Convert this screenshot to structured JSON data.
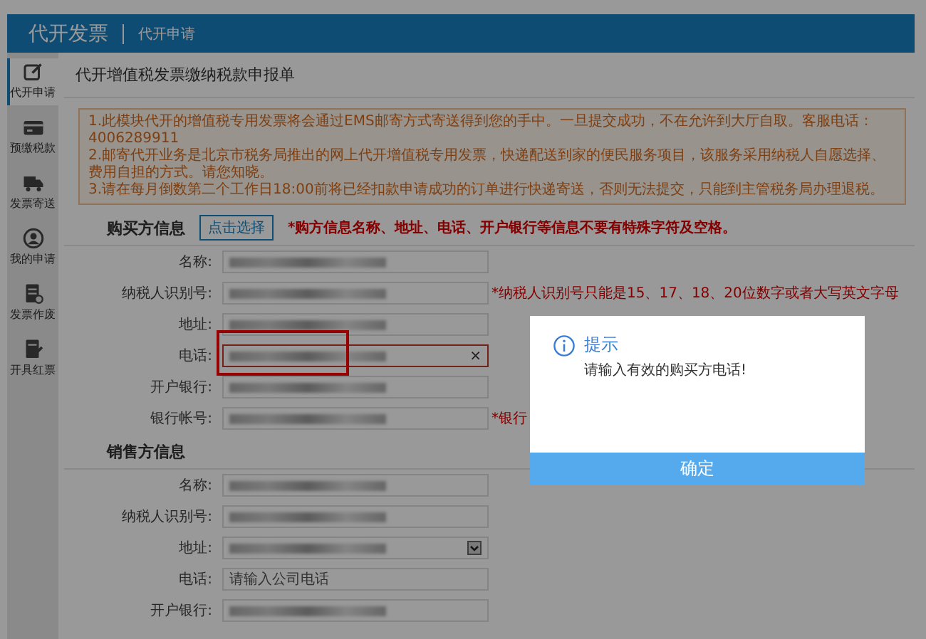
{
  "header": {
    "title": "代开发票",
    "subtitle": "代开申请"
  },
  "sidebar": {
    "items": [
      {
        "label": "代开申请",
        "selected": true
      },
      {
        "label": "预缴税款",
        "selected": false
      },
      {
        "label": "发票寄送",
        "selected": false
      },
      {
        "label": "我的申请",
        "selected": false
      },
      {
        "label": "发票作废",
        "selected": false
      },
      {
        "label": "开具红票",
        "selected": false
      }
    ]
  },
  "page_title": "代开增值税发票缴纳税款申报单",
  "notices": [
    "1.此模块代开的增值税专用发票将会通过EMS邮寄方式寄送得到您的手中。一旦提交成功，不在允许到大厅自取。客服电话：4006289911",
    "2.邮寄代开业务是北京市税务局推出的网上代开增值税专用发票，快递配送到家的便民服务项目，该服务采用纳税人自愿选择、费用自担的方式。请您知晓。",
    "3.请在每月倒数第二个工作日18:00前将已经扣款申请成功的订单进行快递寄送，否则无法提交，只能到主管税务局办理退税。"
  ],
  "buyer": {
    "heading": "购买方信息",
    "select_button": "点击选择",
    "note": "*购方信息名称、地址、电话、开户银行等信息不要有特殊字符及空格。",
    "fields": [
      {
        "label": "名称:",
        "kind": "input",
        "invalid": false
      },
      {
        "label": "纳税人识别号:",
        "kind": "input",
        "invalid": false,
        "note": "*纳税人识别号只能是15、17、18、20位数字或者大写英文字母"
      },
      {
        "label": "地址:",
        "kind": "input",
        "invalid": false
      },
      {
        "label": "电话:",
        "kind": "input",
        "invalid": true,
        "clear": "×",
        "highlighted": true
      },
      {
        "label": "开户银行:",
        "kind": "input",
        "invalid": false
      },
      {
        "label": "银行帐号:",
        "kind": "input",
        "invalid": false,
        "note": "*银行"
      }
    ]
  },
  "seller": {
    "heading": "销售方信息",
    "fields": [
      {
        "label": "名称:",
        "kind": "input",
        "invalid": false
      },
      {
        "label": "纳税人识别号:",
        "kind": "input",
        "invalid": false
      },
      {
        "label": "地址:",
        "kind": "select",
        "invalid": false
      },
      {
        "label": "电话:",
        "kind": "input",
        "invalid": false,
        "placeholder": "请输入公司电话"
      },
      {
        "label": "开户银行:",
        "kind": "input",
        "invalid": false
      }
    ]
  },
  "dialog": {
    "title": "提示",
    "message": "请输入有效的购买方电话!",
    "button": "确定"
  }
}
